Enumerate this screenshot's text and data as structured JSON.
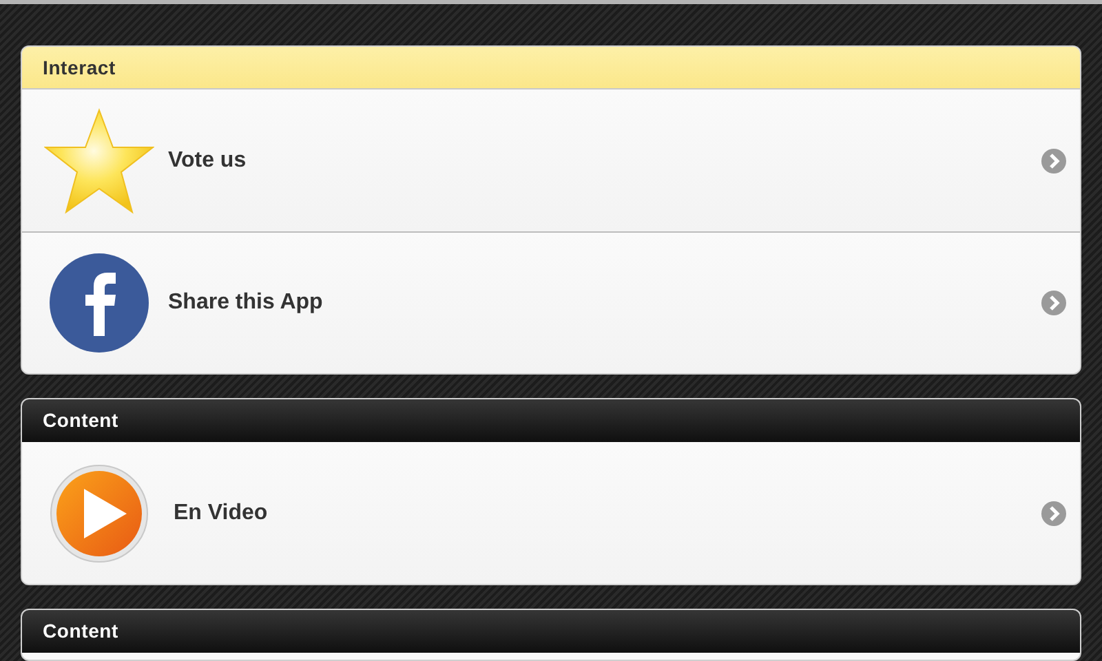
{
  "sections": [
    {
      "title": "Interact",
      "kind": "highlight",
      "rows": [
        {
          "label": "Vote us",
          "kind": "star"
        },
        {
          "label": "Share this App",
          "kind": "facebook"
        }
      ]
    },
    {
      "title": "Content",
      "kind": "dark",
      "rows": [
        {
          "label": "En Video",
          "kind": "play"
        }
      ]
    },
    {
      "title": "Content",
      "kind": "dark"
    }
  ]
}
